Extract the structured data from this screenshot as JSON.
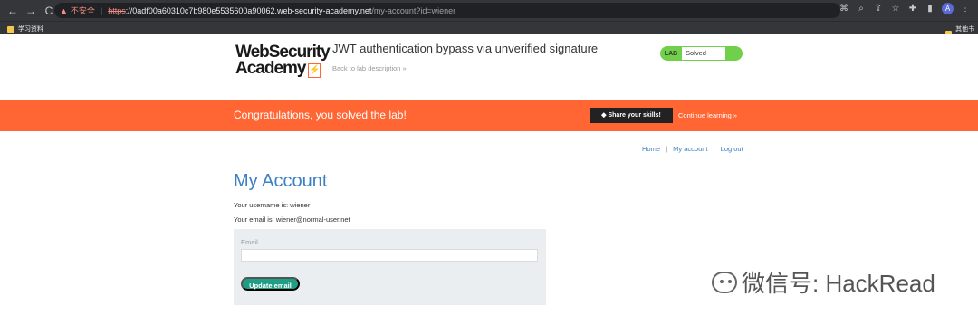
{
  "browser": {
    "warning": "▲",
    "insecure": "不安全",
    "https": "https",
    "host": "://0adf00a60310c7b980e5535600a90062.web-security-academy.net",
    "path": "/my-account?id=wiener",
    "bookmark_left": "学习资料",
    "bookmark_right": "其他书签"
  },
  "header": {
    "logo_line_1": "WebSecurity",
    "logo_line_2": "Academy",
    "logo_mark": "⚡",
    "lab_title": "JWT authentication bypass via unverified signature",
    "back_link": "Back to lab description »",
    "status_label": "LAB",
    "status_value": "Solved"
  },
  "banner": {
    "message": "Congratulations, you solved the lab!",
    "share": "Share your skills!",
    "continue": "Continue learning »"
  },
  "nav": {
    "home": "Home",
    "my_account": "My account",
    "logout": "Log out",
    "separator": "|"
  },
  "account": {
    "title": "My Account",
    "username_line": "Your username is: wiener",
    "email_line": "Your email is: wiener@normal-user.net",
    "email_label": "Email",
    "email_value": "",
    "update_button": "Update email"
  },
  "watermark": {
    "text": "微信号: HackRead"
  }
}
